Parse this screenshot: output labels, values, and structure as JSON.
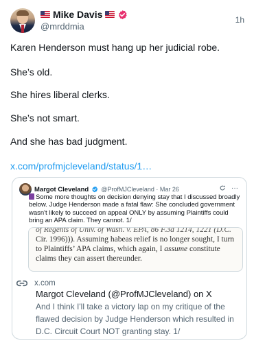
{
  "post": {
    "author_name": "Mike Davis",
    "author_handle": "@mrddmia",
    "time": "1h",
    "lines": [
      "Karen Henderson must hang up her judicial robe.",
      "She’s old.",
      "She hires liberal clerks.",
      "She’s not smart.",
      "And she has bad judgment."
    ],
    "link_text": "x.com/profmjcleveland/status/1…"
  },
  "quote": {
    "author_name": "Margot Cleveland",
    "author_handle": "@ProfMJCleveland · Mar 26",
    "text": "Some more thoughts on decision denying stay that I discussed broadly below. Judge Henderson made a fatal flaw: She concluded government wasn't likely to succeed on appeal ONLY by assuming Plaintiffs could bring an APA claim. They cannot. 1/",
    "doc_lines": {
      "line0": "of Regents of Univ. of Wash. v. EPA, 86 F.3d 1214, 1221 (D.C.",
      "line1": "Cir. 1996))). Assuming habeas relief is no longer sought, I turn",
      "line2a": "to Plaintiffs’ APA claims, which again, I ",
      "line2b": "assume",
      "line2c": " constitute",
      "line3": "claims they can assert thereunder."
    },
    "card": {
      "domain": "x.com",
      "title": "Margot Cleveland (@ProfMJCleveland) on X",
      "description": "And I think I'll take a victory lap on my critique of the flawed decision by Judge Henderson which resulted in D.C. Circuit Court NOT granting stay. 1/"
    }
  },
  "colors": {
    "link": "#1d9bf0",
    "verified_badge": "#e8316f",
    "quote_verified_badge": "#1d9bf0"
  }
}
